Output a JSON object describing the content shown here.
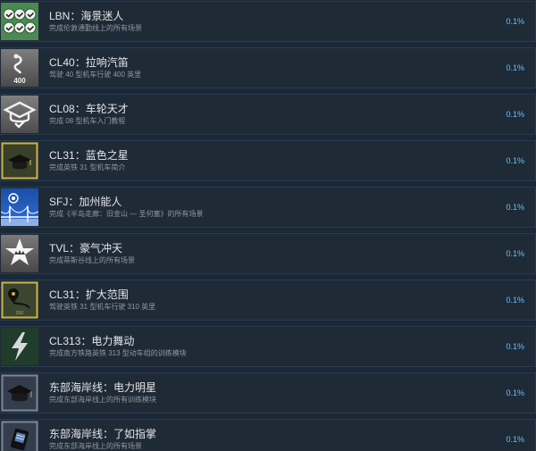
{
  "achievements": [
    {
      "icon": "checkmarks-icon",
      "title": "LBN：海景迷人",
      "desc": "完成伦敦通勤线上的所有场景",
      "percent": "0.1%"
    },
    {
      "icon": "route-400-icon",
      "title": "CL40：拉响汽笛",
      "desc": "驾驶 40 型机车行驶 400 英里",
      "percent": "0.1%"
    },
    {
      "icon": "graduation-cap-icon",
      "title": "CL08：车轮天才",
      "desc": "完成 08 型机车入门教程",
      "percent": "0.1%"
    },
    {
      "icon": "gold-cap-icon",
      "title": "CL31：蓝色之星",
      "desc": "完成英铁 31 型机车简介",
      "percent": "0.1%"
    },
    {
      "icon": "bridge-icon",
      "title": "SFJ：加州能人",
      "desc": "完成《半岛走廊：旧金山 — 圣何塞》的所有场景",
      "percent": "0.1%"
    },
    {
      "icon": "crown-star-icon",
      "title": "TVL：豪气冲天",
      "desc": "完成蒂斯谷线上的所有场景",
      "percent": "0.1%"
    },
    {
      "icon": "map-pin-icon",
      "title": "CL31：扩大范围",
      "desc": "驾驶英铁 31 型机车行驶 310 英里",
      "percent": "0.1%"
    },
    {
      "icon": "lightning-icon",
      "title": "CL313：电力舞动",
      "desc": "完成南方铁路英铁 313 型动车组的训练模块",
      "percent": "0.1%"
    },
    {
      "icon": "mortarboard-icon",
      "title": "东部海岸线：电力明星",
      "desc": "完成东部海岸线上的所有训练模块",
      "percent": "0.1%"
    },
    {
      "icon": "device-icon",
      "title": "东部海岸线：了如指掌",
      "desc": "完成东部海岸线上的所有场景",
      "percent": "0.1%"
    }
  ]
}
